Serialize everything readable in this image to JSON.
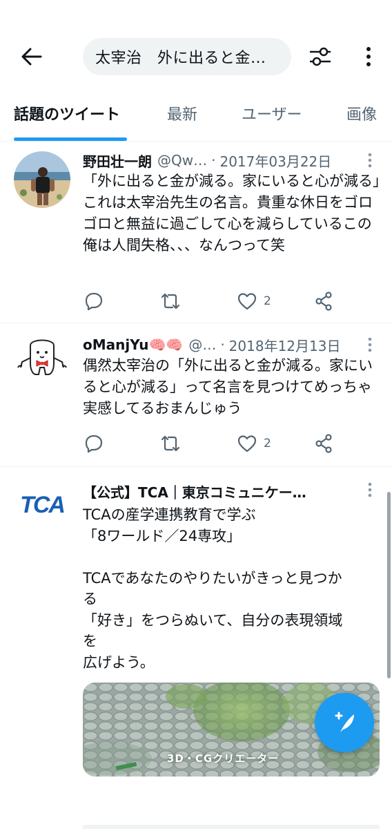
{
  "header": {
    "search_text": "太宰治　外に出ると金…"
  },
  "tabs": [
    {
      "label": "話題のツイート"
    },
    {
      "label": "最新"
    },
    {
      "label": "ユーザー"
    },
    {
      "label": "画像"
    }
  ],
  "tweets": [
    {
      "name": "野田壮一朗",
      "handle": "@Qw…",
      "dot": "·",
      "date": "2017年03月22日",
      "text": "「外に出ると金が減る。家にいると心が減る」これは太宰治先生の名言。貴重な休日をゴロゴロと無益に過ごして心を減らしているこの俺は人間失格、、、なんつって笑",
      "likes": "2"
    },
    {
      "name": "oManjYu🧠🧠",
      "handle": "@…",
      "dot": "·",
      "date": "2018年12月13日",
      "text": "偶然太宰治の「外に出ると金が減る。家にいると心が減る」って名言を見つけてめっちゃ実感してるおまんじゅう",
      "likes": "2"
    },
    {
      "name": "【公式】TCA｜東京コミュニケー…",
      "logo_text": "TCA",
      "lines": [
        "TCAの産学連携教育で学ぶ",
        "「8ワールド／24専攻」",
        "",
        "TCAであなたのやりたいがきっと見つか",
        "る",
        "「好き」をつらぬいて、自分の表現領域",
        "を",
        "広げよう。"
      ],
      "media_caption": "3D・CGクリエーター"
    }
  ],
  "colors": {
    "accent": "#1d9bf0",
    "text_secondary": "#536471",
    "tca_blue": "#1a5fb4"
  }
}
